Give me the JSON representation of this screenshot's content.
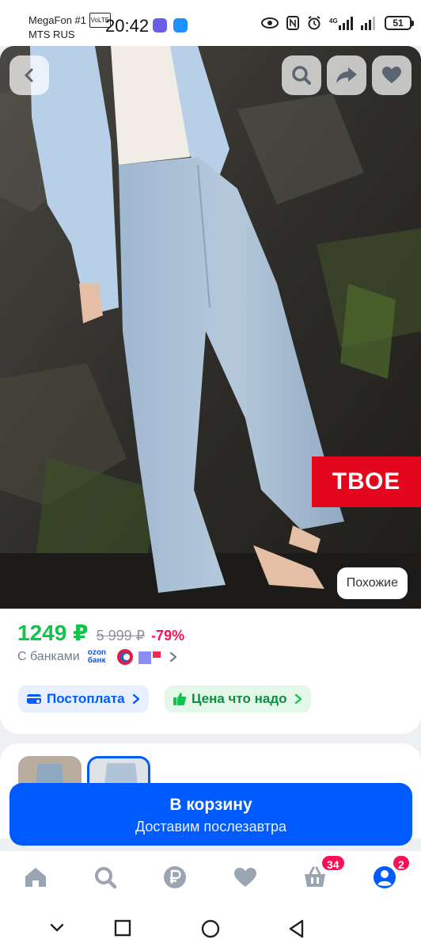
{
  "status_bar": {
    "carrier_line1": "MegaFon #1",
    "volte": "VoLTE",
    "carrier_line2": "MTS RUS",
    "time": "20:42",
    "network": "4G",
    "battery": "51"
  },
  "product_photo": {
    "brand_badge": "ТВОЕ",
    "similar_label": "Похожие"
  },
  "price": {
    "current": "1249 ₽",
    "old": "5 999 ₽",
    "discount": "-79%",
    "bank_label": "С банками",
    "ozon_bank_line1": "ozon",
    "ozon_bank_line2": "банк"
  },
  "chips": {
    "postpay_label": "Постоплата",
    "price_label": "Цена что надо"
  },
  "cart_button": {
    "title": "В корзину",
    "subtitle": "Доставим послезавтра"
  },
  "bottom_nav": {
    "cart_badge": "34",
    "profile_badge": "2",
    "items": [
      "home-icon",
      "search-icon",
      "ruble-icon",
      "heart-icon",
      "basket-icon",
      "profile-icon"
    ]
  },
  "colors": {
    "accent_blue": "#005bff",
    "price_green": "#10c44c",
    "discount_pink": "#f91155",
    "brand_red": "#e3061d"
  }
}
